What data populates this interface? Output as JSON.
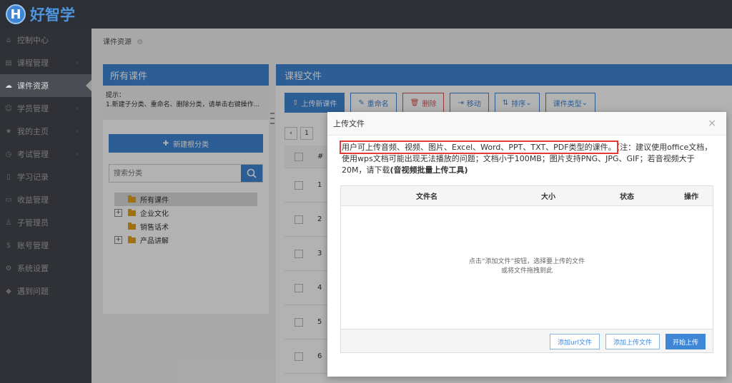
{
  "app": {
    "logo_letter": "H",
    "logo_text": "好智学"
  },
  "sidebar": {
    "items": [
      {
        "label": "控制中心",
        "icon": "home-icon"
      },
      {
        "label": "课程管理",
        "icon": "book-icon"
      },
      {
        "label": "课件资源",
        "icon": "cloud-icon"
      },
      {
        "label": "学员管理",
        "icon": "users-icon"
      },
      {
        "label": "我的主页",
        "icon": "star-icon"
      },
      {
        "label": "考试管理",
        "icon": "clock-icon"
      },
      {
        "label": "学习记录",
        "icon": "document-icon"
      },
      {
        "label": "收益管理",
        "icon": "card-icon"
      },
      {
        "label": "子管理员",
        "icon": "person-icon"
      },
      {
        "label": "账号管理",
        "icon": "dollar-icon"
      },
      {
        "label": "系统设置",
        "icon": "gear-icon"
      },
      {
        "label": "遇到问题",
        "icon": "pin-icon"
      }
    ],
    "arrow": "‹",
    "active_index": 2
  },
  "breadcrumb": "课件资源",
  "left_panel": {
    "title": "所有课件",
    "hint_line1": "提示：",
    "hint_line2": "1.新建子分类、重命名、删除分类，请单击右键操作...",
    "new_root_button": "新建根分类",
    "search_placeholder": "搜索分类",
    "tree": [
      {
        "label": "所有课件",
        "expandable": false,
        "selected": true
      },
      {
        "label": "企业文化",
        "expandable": true,
        "selected": false
      },
      {
        "label": "销售话术",
        "expandable": false,
        "selected": false
      },
      {
        "label": "产品讲解",
        "expandable": true,
        "selected": false
      }
    ]
  },
  "right_panel": {
    "title": "课程文件",
    "toolbar": {
      "upload": "上传新课件",
      "rename": "重命名",
      "delete": "删除",
      "move": "移动",
      "sort": "排序",
      "type": "课件类型"
    },
    "pager_prev": "‹",
    "pager_page": "1",
    "rows_header": "#",
    "rows": [
      "1",
      "2",
      "3",
      "4",
      "5",
      "6"
    ]
  },
  "modal": {
    "title": "上传文件",
    "close": "×",
    "notice_highlight": "用户可上传音频、视频、图片、Excel、Word、PPT、TXT、PDF类型的课件。",
    "notice_rest": "（注：建议使用office文档，使用wps文档可能出现无法播放的问题；文档小于100MB；图片支持PNG、JPG、GIF；若音视频大于20M，请下载",
    "notice_bold": "(音视频批量上传工具)",
    "columns": {
      "name": "文件名",
      "size": "大小",
      "status": "状态",
      "action": "操作"
    },
    "placeholder_line1": "点击“添加文件”按钮，选择要上传的文件",
    "placeholder_line2": "或将文件拖拽到此",
    "buttons": {
      "add_url": "添加url文件",
      "add_file": "添加上传文件",
      "start": "开始上传"
    }
  }
}
